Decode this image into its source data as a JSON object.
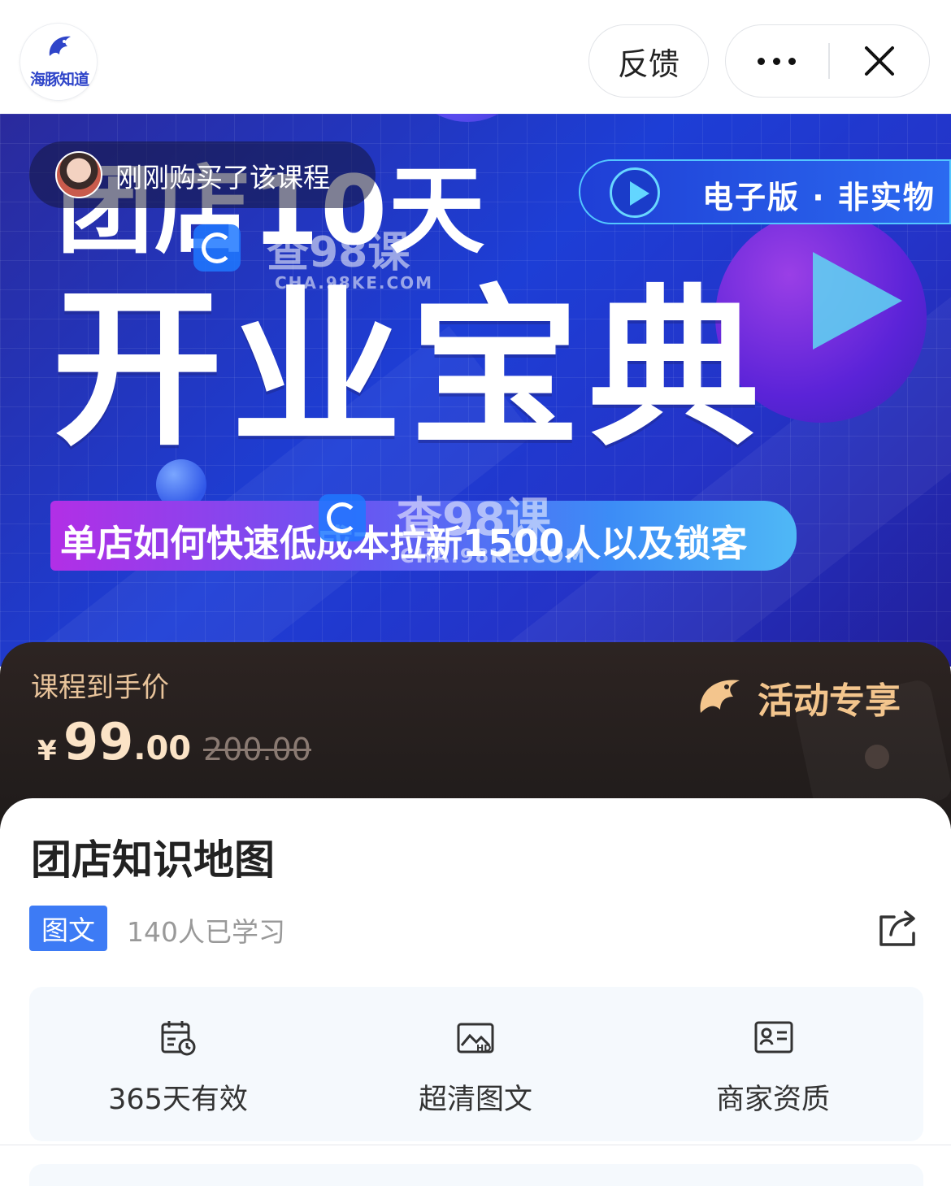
{
  "header": {
    "logo_text": "海豚知道",
    "feedback_label": "反馈",
    "more_icon": "more-dots-icon",
    "close_icon": "close-icon"
  },
  "banner": {
    "purchase_notice": "刚刚购买了该课程",
    "edition_label": "电子版 · 非实物",
    "title_small": "团店10天",
    "title_big": "开业宝典",
    "subtitle": "单店如何快速低成本拉新1500人以及锁客",
    "watermark_1": "查98课",
    "watermark_1_url": "CHA.98KE.COM",
    "watermark_2": "查98课",
    "watermark_2_url": "CHA.98KE.COM"
  },
  "price": {
    "label": "课程到手价",
    "currency": "¥",
    "integer": "99",
    "decimal": ".00",
    "original": "200.00",
    "promo_label": "活动专享"
  },
  "course": {
    "title": "团店知识地图",
    "type_tag": "图文",
    "learners": "140人已学习",
    "share_icon": "share-icon"
  },
  "features": [
    {
      "icon": "calendar-clock-icon",
      "label": "365天有效"
    },
    {
      "icon": "hd-image-icon",
      "label": "超清图文"
    },
    {
      "icon": "id-card-icon",
      "label": "商家资质"
    }
  ],
  "colors": {
    "brand_blue": "#3d7bf5",
    "price_gold": "#fbe3c6",
    "promo_gold": "#f3c58d",
    "banner_blue": "#1d3ed6"
  }
}
